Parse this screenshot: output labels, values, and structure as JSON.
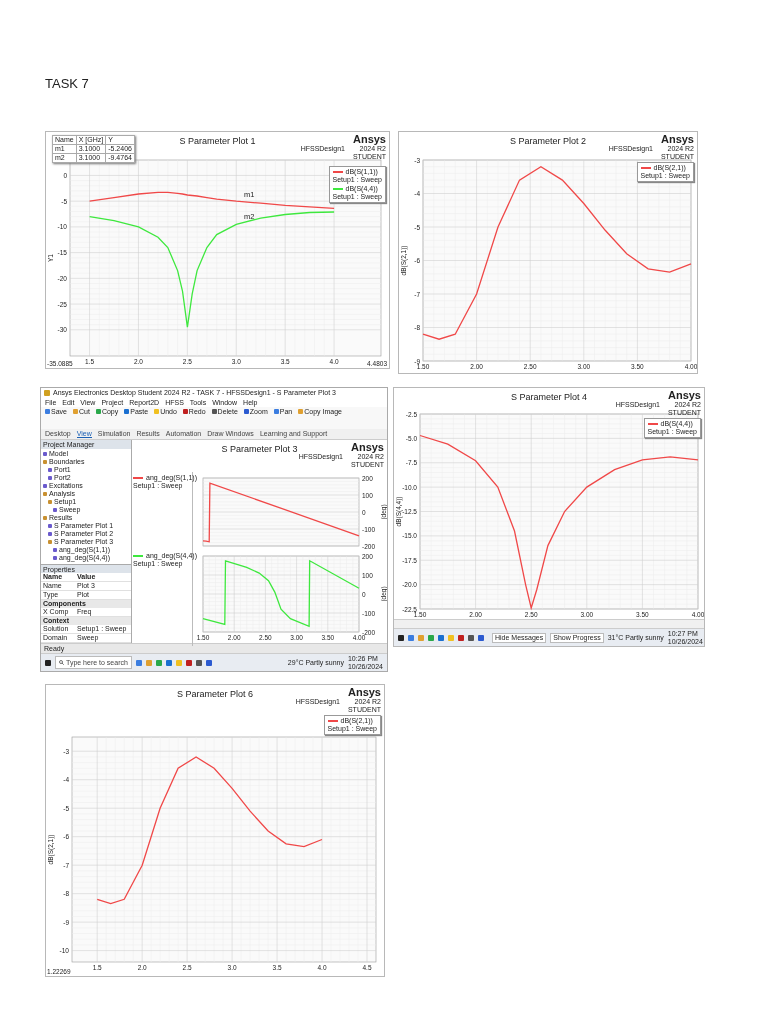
{
  "heading": "TASK 7",
  "plots": [
    {
      "kind": "card",
      "title": "S Parameter Plot 1",
      "design": "HFSSDesign1",
      "brand": "Ansys",
      "version": "2024 R2",
      "edition": "STUDENT",
      "legend_setups": [
        "Setup1 : Sweep",
        "Setup1 : Sweep"
      ],
      "corner_labels": [
        "-35.0885",
        "4.4803"
      ],
      "marker_table": {
        "columns": [
          "Name",
          "X [GHz]",
          "Y"
        ],
        "rows": [
          [
            "m1",
            "3.1000",
            "-5.2406"
          ],
          [
            "m2",
            "3.1000",
            "-9.4764"
          ]
        ]
      },
      "chart_data": {
        "type": "line",
        "grid": true,
        "ylabel": "Y1",
        "xlim": [
          1.3,
          4.48
        ],
        "ylim": [
          -35.09,
          3
        ],
        "x": [
          1.5,
          1.75,
          2.0,
          2.2,
          2.3,
          2.4,
          2.45,
          2.5,
          2.55,
          2.6,
          2.7,
          2.8,
          3.0,
          3.25,
          3.5,
          3.75,
          4.0
        ],
        "xticks": [
          {
            "value": 1.5,
            "label": "1.5"
          },
          {
            "value": 2.0,
            "label": "2.0"
          },
          {
            "value": 2.5,
            "label": "2.5"
          },
          {
            "value": 3.0,
            "label": "3.0"
          },
          {
            "value": 3.5,
            "label": "3.5"
          },
          {
            "value": 4.0,
            "label": "4.0"
          }
        ],
        "yticks": [
          {
            "value": 0,
            "label": "0"
          },
          {
            "value": -5,
            "label": "-5"
          },
          {
            "value": -10,
            "label": "-10"
          },
          {
            "value": -15,
            "label": "-15"
          },
          {
            "value": -20,
            "label": "-20"
          },
          {
            "value": -25,
            "label": "-25"
          },
          {
            "value": -30,
            "label": "-30"
          }
        ],
        "series": [
          {
            "name": "dB(S(1,1))",
            "color": "#f04848",
            "values": [
              -5.0,
              -4.3,
              -3.6,
              -3.3,
              -3.3,
              -3.5,
              -3.6,
              -3.8,
              -3.9,
              -4.0,
              -4.3,
              -4.6,
              -5.0,
              -5.4,
              -5.8,
              -6.1,
              -6.4
            ]
          },
          {
            "name": "dB(S(4,4))",
            "color": "#3ee83e",
            "values": [
              -8.0,
              -8.8,
              -10.0,
              -12.0,
              -14.0,
              -18.5,
              -22.5,
              -29.5,
              -23.0,
              -18.5,
              -14.0,
              -11.5,
              -9.5,
              -8.3,
              -7.6,
              -7.2,
              -7.1
            ]
          }
        ],
        "annotations": [
          {
            "text": "m1",
            "x": 3.1,
            "y": -5.2
          },
          {
            "text": "m2",
            "x": 3.1,
            "y": -9.5
          }
        ]
      }
    },
    {
      "kind": "card",
      "title": "S Parameter Plot 2",
      "design": "HFSSDesign1",
      "brand": "Ansys",
      "version": "2024 R2",
      "edition": "STUDENT",
      "legend_setups": [
        "Setup1 : Sweep"
      ],
      "chart_data": {
        "type": "line",
        "grid": true,
        "ylabel": "dB(S(2,1))",
        "xlim": [
          1.5,
          4.0
        ],
        "ylim": [
          -9,
          -3
        ],
        "x": [
          1.5,
          1.65,
          1.8,
          2.0,
          2.2,
          2.4,
          2.6,
          2.8,
          3.0,
          3.2,
          3.4,
          3.6,
          3.8,
          4.0
        ],
        "xticks": [
          {
            "value": 1.5,
            "label": "1.50"
          },
          {
            "value": 2.0,
            "label": "2.00"
          },
          {
            "value": 2.5,
            "label": "2.50"
          },
          {
            "value": 3.0,
            "label": "3.00"
          },
          {
            "value": 3.5,
            "label": "3.50"
          },
          {
            "value": 4.0,
            "label": "4.00"
          }
        ],
        "yticks": [
          {
            "value": -3,
            "label": "-3"
          },
          {
            "value": -4,
            "label": "-4"
          },
          {
            "value": -5,
            "label": "-5"
          },
          {
            "value": -6,
            "label": "-6"
          },
          {
            "value": -7,
            "label": "-7"
          },
          {
            "value": -8,
            "label": "-8"
          },
          {
            "value": -9,
            "label": "-9"
          }
        ],
        "series": [
          {
            "name": "dB(S(2,1))",
            "color": "#f04848",
            "values": [
              -8.2,
              -8.35,
              -8.2,
              -7.0,
              -5.0,
              -3.6,
              -3.2,
              -3.6,
              -4.3,
              -5.1,
              -5.8,
              -6.25,
              -6.35,
              -6.1
            ]
          }
        ]
      }
    },
    {
      "kind": "window",
      "title": "Ansys Electronics Desktop Student 2024 R2 - TASK 7 - HFSSDesign1 - S Parameter Plot 3",
      "menu": [
        "File",
        "Edit",
        "View",
        "Project",
        "Report2D",
        "HFSS",
        "Tools",
        "Window",
        "Help"
      ],
      "ribbon_buttons": [
        "Save",
        "Cut",
        "Copy",
        "Paste",
        "Undo",
        "Redo",
        "Delete",
        "Zoom",
        "Pan",
        "Copy Image"
      ],
      "ribbon_tabs": [
        {
          "label": "Desktop",
          "selected": false
        },
        {
          "label": "View",
          "selected": true
        },
        {
          "label": "Simulation",
          "selected": false
        },
        {
          "label": "Results",
          "selected": false
        },
        {
          "label": "Automation",
          "selected": false
        },
        {
          "label": "Draw Windows",
          "selected": false
        },
        {
          "label": "Learning and Support",
          "selected": false
        }
      ],
      "tree_title": "Project Manager",
      "tree": [
        {
          "label": "Model"
        },
        {
          "label": "Boundaries",
          "children": [
            {
              "label": "Port1"
            },
            {
              "label": "Port2"
            }
          ]
        },
        {
          "label": "Excitations"
        },
        {
          "label": "Analysis",
          "children": [
            {
              "label": "Setup1",
              "children": [
                {
                  "label": "Sweep"
                }
              ]
            }
          ]
        },
        {
          "label": "Results",
          "children": [
            {
              "label": "S Parameter Plot 1"
            },
            {
              "label": "S Parameter Plot 2"
            },
            {
              "label": "S Parameter Plot 3",
              "children": [
                {
                  "label": "ang_deg(S(1,1))"
                },
                {
                  "label": "ang_deg(S(4,4))"
                }
              ]
            }
          ]
        }
      ],
      "properties_title": "Properties",
      "properties_columns": [
        "Name",
        "Value"
      ],
      "properties": [
        {
          "kind": "row",
          "name": "Name",
          "value": "Plot 3"
        },
        {
          "kind": "row",
          "name": "Type",
          "value": "Plot"
        },
        {
          "kind": "section",
          "name": "Components"
        },
        {
          "kind": "row",
          "name": "X Comp",
          "value": "Freq"
        },
        {
          "kind": "section",
          "name": "Context"
        },
        {
          "kind": "row",
          "name": "Solution",
          "value": "Setup1 : Sweep"
        },
        {
          "kind": "row",
          "name": "Domain",
          "value": "Sweep"
        }
      ],
      "status": "Ready",
      "plot_title": "S Parameter Plot 3",
      "design": "HFSSDesign1",
      "brand": "Ansys",
      "version": "2024 R2",
      "edition": "STUDENT",
      "subplots": [
        {
          "setup": "Setup1 : Sweep",
          "chart_data": {
            "type": "line",
            "grid": true,
            "ylabel": "(deg)",
            "xlim": [
              1.5,
              4.0
            ],
            "ylim": [
              -200,
              200
            ],
            "x": [
              1.5,
              1.55,
              1.6,
              1.61,
              4.0
            ],
            "yticks": [
              {
                "value": 200,
                "label": "200"
              },
              {
                "value": 100,
                "label": "100"
              },
              {
                "value": 0,
                "label": "0"
              },
              {
                "value": -100,
                "label": "-100"
              },
              {
                "value": -200,
                "label": "-200"
              }
            ],
            "series": [
              {
                "name": "ang_deg(S(1,1))",
                "color": "#f04848",
                "values": [
                  -170,
                  -172,
                  -175,
                  170,
                  -140
                ]
              }
            ]
          }
        },
        {
          "setup": "Setup1 : Sweep",
          "chart_data": {
            "type": "line",
            "grid": true,
            "ylabel": "(deg)",
            "xlim": [
              1.5,
              4.0
            ],
            "ylim": [
              -200,
              200
            ],
            "x": [
              1.5,
              1.85,
              1.86,
              2.2,
              2.4,
              2.55,
              2.65,
              2.75,
              2.9,
              3.2,
              3.21,
              4.0
            ],
            "xticks": [
              {
                "value": 1.5,
                "label": "1.50"
              },
              {
                "value": 2.0,
                "label": "2.00"
              },
              {
                "value": 2.5,
                "label": "2.50"
              },
              {
                "value": 3.0,
                "label": "3.00"
              },
              {
                "value": 3.5,
                "label": "3.50"
              },
              {
                "value": 4.0,
                "label": "4.00"
              }
            ],
            "yticks": [
              {
                "value": 200,
                "label": "200"
              },
              {
                "value": 100,
                "label": "100"
              },
              {
                "value": 0,
                "label": "0"
              },
              {
                "value": -100,
                "label": "-100"
              },
              {
                "value": -200,
                "label": "-200"
              }
            ],
            "series": [
              {
                "name": "ang_deg(S(4,4))",
                "color": "#3ee83e",
                "values": [
                  -130,
                  -160,
                  175,
                  140,
                  110,
                  70,
                  10,
                  -80,
                  -130,
                  -170,
                  175,
                  30
                ]
              }
            ]
          }
        }
      ],
      "taskbar": {
        "search": "Type here to search",
        "weather": "29°C Partly sunny",
        "time": "10:26 PM",
        "date": "10/26/2024"
      }
    },
    {
      "kind": "card",
      "title": "S Parameter Plot 4",
      "design": "HFSSDesign1",
      "brand": "Ansys",
      "version": "2024 R2",
      "edition": "STUDENT",
      "legend_setups": [
        "Setup1 : Sweep"
      ],
      "chart_data": {
        "type": "line",
        "grid": true,
        "ylabel": "dB(S(4,4))",
        "xlim": [
          1.5,
          4.0
        ],
        "ylim": [
          -22.5,
          -2.5
        ],
        "x": [
          1.5,
          1.75,
          2.0,
          2.2,
          2.35,
          2.45,
          2.5,
          2.55,
          2.65,
          2.8,
          3.0,
          3.25,
          3.5,
          3.75,
          4.0
        ],
        "xticks": [
          {
            "value": 1.5,
            "label": "1.50"
          },
          {
            "value": 2.0,
            "label": "2.00"
          },
          {
            "value": 2.5,
            "label": "2.50"
          },
          {
            "value": 3.0,
            "label": "3.00"
          },
          {
            "value": 3.5,
            "label": "3.50"
          },
          {
            "value": 4.0,
            "label": "4.00"
          }
        ],
        "yticks": [
          {
            "value": -2.5,
            "label": "-2.5"
          },
          {
            "value": -5,
            "label": "-5.0"
          },
          {
            "value": -7.5,
            "label": "-7.5"
          },
          {
            "value": -10,
            "label": "-10.0"
          },
          {
            "value": -12.5,
            "label": "-12.5"
          },
          {
            "value": -15,
            "label": "-15.0"
          },
          {
            "value": -17.5,
            "label": "-17.5"
          },
          {
            "value": -20,
            "label": "-20.0"
          },
          {
            "value": -22.5,
            "label": "-22.5"
          }
        ],
        "series": [
          {
            "name": "dB(S(4,4))",
            "color": "#f04848",
            "values": [
              -4.7,
              -5.6,
              -7.3,
              -10.0,
              -14.5,
              -20.0,
              -22.4,
              -20.5,
              -16.0,
              -12.5,
              -10.0,
              -8.2,
              -7.2,
              -6.9,
              -7.2
            ]
          }
        ]
      },
      "taskbar": {
        "buttons": [
          "Hide Messages",
          "Show Progress"
        ],
        "weather": "31°C Partly sunny",
        "time": "10:27 PM",
        "date": "10/26/2024"
      }
    },
    {
      "kind": "card",
      "title": "S Parameter Plot 6",
      "design": "HFSSDesign1",
      "brand": "Ansys",
      "version": "2024 R2",
      "edition": "STUDENT",
      "legend_setups": [
        "Setup1 : Sweep"
      ],
      "corner_labels": [
        "1.22269"
      ],
      "chart_data": {
        "type": "line",
        "grid": true,
        "ylabel": "dB(S(2,1))",
        "xlim": [
          1.22,
          4.6
        ],
        "ylim": [
          -10.4,
          -2.5
        ],
        "x": [
          1.5,
          1.65,
          1.8,
          2.0,
          2.2,
          2.4,
          2.6,
          2.8,
          3.0,
          3.2,
          3.4,
          3.6,
          3.8,
          4.0
        ],
        "xticks": [
          {
            "value": 1.5,
            "label": "1.5"
          },
          {
            "value": 2.0,
            "label": "2.0"
          },
          {
            "value": 2.5,
            "label": "2.5"
          },
          {
            "value": 3.0,
            "label": "3.0"
          },
          {
            "value": 3.5,
            "label": "3.5"
          },
          {
            "value": 4.0,
            "label": "4.0"
          },
          {
            "value": 4.5,
            "label": "4.5"
          }
        ],
        "yticks": [
          {
            "value": -3,
            "label": "-3"
          },
          {
            "value": -4,
            "label": "-4"
          },
          {
            "value": -5,
            "label": "-5"
          },
          {
            "value": -6,
            "label": "-6"
          },
          {
            "value": -7,
            "label": "-7"
          },
          {
            "value": -8,
            "label": "-8"
          },
          {
            "value": -9,
            "label": "-9"
          },
          {
            "value": -10,
            "label": "-10"
          }
        ],
        "series": [
          {
            "name": "dB(S(2,1))",
            "color": "#f04848",
            "values": [
              -8.2,
              -8.35,
              -8.2,
              -7.0,
              -5.0,
              -3.6,
              -3.2,
              -3.6,
              -4.3,
              -5.1,
              -5.8,
              -6.25,
              -6.35,
              -6.1
            ]
          }
        ]
      }
    }
  ]
}
